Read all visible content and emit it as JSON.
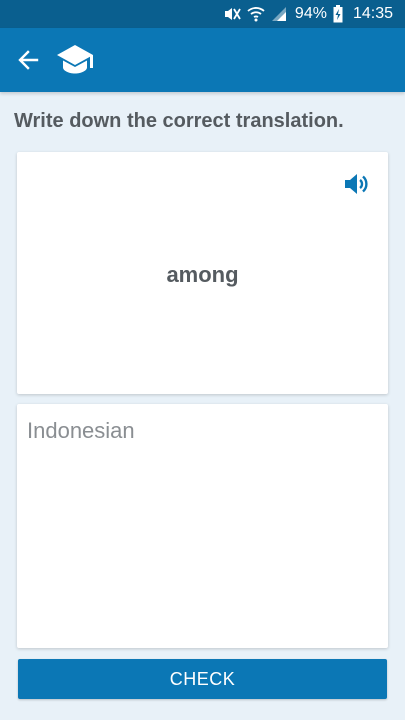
{
  "status_bar": {
    "battery": "94%",
    "time": "14:35",
    "icons": [
      "mute-icon",
      "wifi-icon",
      "signal-icon",
      "battery-charging-icon"
    ]
  },
  "app_bar": {
    "icons": [
      "back-arrow-icon",
      "graduation-cap-icon"
    ],
    "color": "#0b77b5"
  },
  "exercise": {
    "instruction": "Write down the correct translation.",
    "word": "among",
    "speaker_icon": "speaker-icon",
    "answer_placeholder": "Indonesian",
    "answer_value": ""
  },
  "actions": {
    "check_label": "CHECK"
  },
  "colors": {
    "primary": "#0b77b5",
    "status_bar": "#0a5f8f",
    "background": "#e8f1f8",
    "text": "#555b60"
  }
}
